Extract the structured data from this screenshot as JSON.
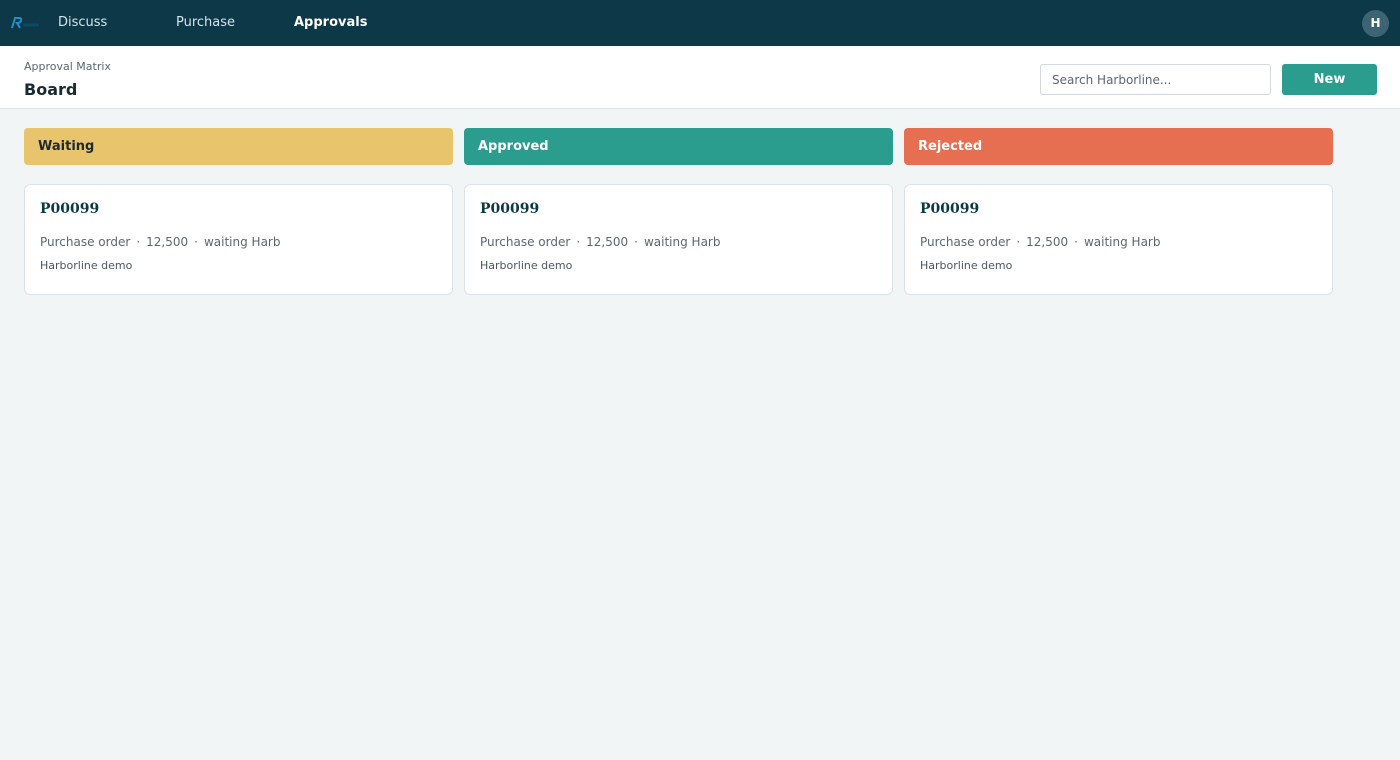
{
  "nav": {
    "items": [
      {
        "label": "Discuss"
      },
      {
        "label": "Purchase"
      },
      {
        "label": "Approvals"
      }
    ],
    "active": "Approvals",
    "avatar_initial": "H"
  },
  "header": {
    "breadcrumb": "Approval Matrix",
    "title": "Board",
    "search_placeholder": "Search Harborline...",
    "new_label": "New"
  },
  "columns": [
    {
      "title": "Waiting",
      "color": "#e8c46c",
      "text_color": "#1f2a30",
      "cards": [
        {
          "ref": "P00099",
          "type": "Purchase order",
          "amount": "12,500",
          "status": "waiting Harb",
          "company": "Harborline demo"
        }
      ]
    },
    {
      "title": "Approved",
      "color": "#2a9d8f",
      "text_color": "#ffffff",
      "cards": [
        {
          "ref": "P00099",
          "type": "Purchase order",
          "amount": "12,500",
          "status": "waiting Harb",
          "company": "Harborline demo"
        }
      ]
    },
    {
      "title": "Rejected",
      "color": "#e76f51",
      "text_color": "#ffffff",
      "cards": [
        {
          "ref": "P00099",
          "type": "Purchase order",
          "amount": "12,500",
          "status": "waiting Harb",
          "company": "Harborline demo"
        }
      ]
    }
  ],
  "separator": "·",
  "colors": {
    "topbar": "#0d3848",
    "accent": "#2a9d8f",
    "background": "#f1f5f5"
  },
  "icons": {
    "logo": "app-logo-icon"
  }
}
